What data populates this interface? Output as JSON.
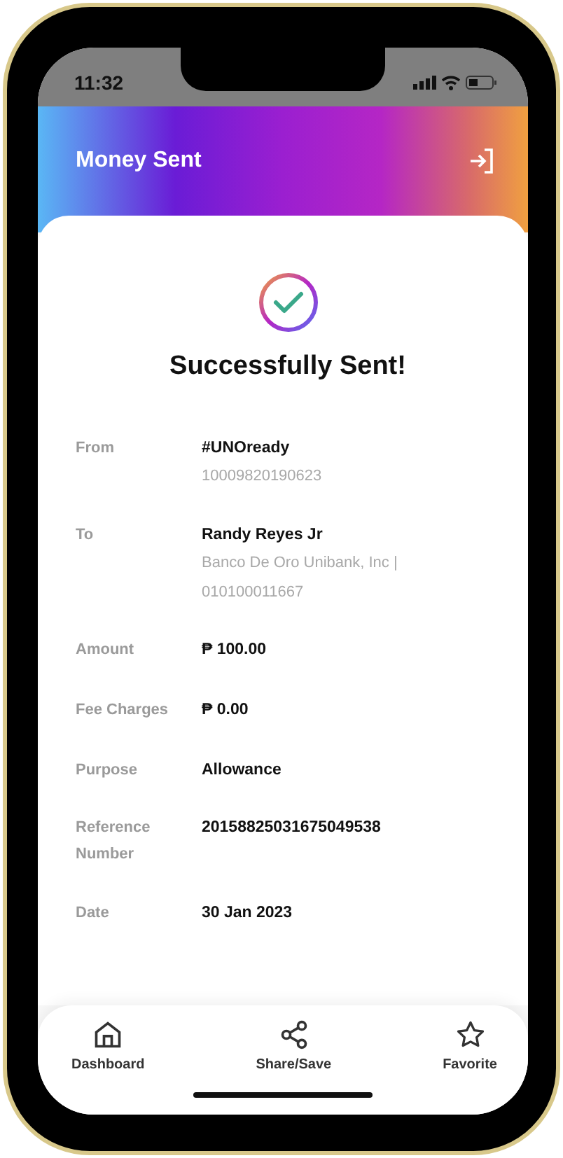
{
  "status_bar": {
    "time": "11:32"
  },
  "header": {
    "title": "Money Sent"
  },
  "result": {
    "title": "Successfully Sent!"
  },
  "details": [
    {
      "label": "From",
      "value": "#UNOready",
      "sub": [
        "10009820190623"
      ]
    },
    {
      "label": "To",
      "value": "Randy Reyes Jr",
      "sub": [
        "Banco De Oro Unibank, Inc |",
        "010100011667"
      ]
    },
    {
      "label": "Amount",
      "value": "₱ 100.00"
    },
    {
      "label": "Fee Charges",
      "value": "₱ 0.00"
    },
    {
      "label": "Purpose",
      "value": "Allowance"
    },
    {
      "label": "Reference Number",
      "value": "20158825031675049538"
    },
    {
      "label": "Date",
      "value": "30 Jan 2023"
    }
  ],
  "bottom_nav": [
    {
      "kind": "home",
      "label": "Dashboard"
    },
    {
      "kind": "share",
      "label": "Share/Save"
    },
    {
      "kind": "star",
      "label": "Favorite"
    }
  ]
}
